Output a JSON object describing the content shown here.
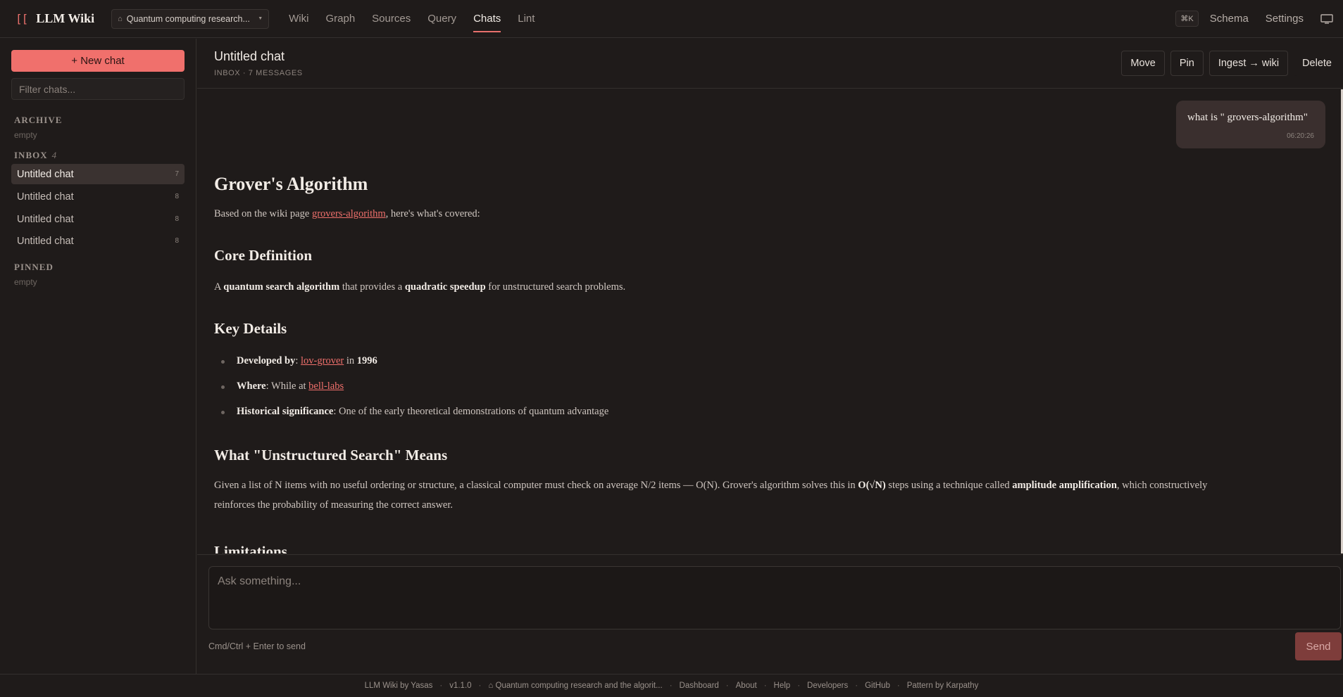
{
  "app": {
    "logo_mark": "[[",
    "title": "LLM Wiki",
    "project": "Quantum computing research...",
    "project_icon": "home-icon"
  },
  "nav": {
    "items": [
      {
        "label": "Wiki"
      },
      {
        "label": "Graph"
      },
      {
        "label": "Sources"
      },
      {
        "label": "Query"
      },
      {
        "label": "Chats",
        "active": true
      },
      {
        "label": "Lint"
      }
    ],
    "shortcut": "⌘K",
    "schema": "Schema",
    "settings": "Settings"
  },
  "sidebar": {
    "new_chat": "+ New chat",
    "filter_placeholder": "Filter chats...",
    "archive": {
      "title": "ARCHIVE",
      "empty": "empty"
    },
    "inbox": {
      "title": "INBOX",
      "count": "4",
      "items": [
        {
          "label": "Untitled chat",
          "count": "7",
          "active": true
        },
        {
          "label": "Untitled chat",
          "count": "8"
        },
        {
          "label": "Untitled chat",
          "count": "8"
        },
        {
          "label": "Untitled chat",
          "count": "8"
        }
      ]
    },
    "pinned": {
      "title": "PINNED",
      "empty": "empty"
    }
  },
  "chat": {
    "title": "Untitled chat",
    "subtitle": "INBOX · 7 MESSAGES",
    "buttons": {
      "move": "Move",
      "pin": "Pin",
      "ingest": "Ingest → wiki",
      "delete": "Delete"
    },
    "user_message": {
      "text": "what is \" grovers-algorithm\"",
      "time": "06:20:26"
    },
    "answer": {
      "h1": "Grover's Algorithm",
      "intro_prefix": "Based on the wiki page ",
      "intro_link": "grovers-algorithm",
      "intro_suffix": ", here's what's covered:",
      "core_heading": "Core Definition",
      "core_a": "A ",
      "core_b1": "quantum search algorithm",
      "core_c": " that provides a ",
      "core_b2": "quadratic speedup",
      "core_d": " for unstructured search problems.",
      "key_heading": "Key Details",
      "dev_label": "Developed by",
      "dev_sep": ": ",
      "dev_link": "lov-grover",
      "dev_in": " in ",
      "dev_year": "1996",
      "where_label": "Where",
      "where_text": ": While at ",
      "where_link": "bell-labs",
      "hist_label": "Historical significance",
      "hist_text": ": One of the early theoretical demonstrations of quantum advantage",
      "unstructured_heading": "What \"Unstructured Search\" Means",
      "us_a": "Given a list of N items with no useful ordering or structure, a classical computer must check on average N/2 items — O(N). Grover's algorithm solves this in ",
      "us_b1": "O(√N)",
      "us_c": " steps using a technique called ",
      "us_b2": "amplitude amplification",
      "us_d": ", which constructively reinforces the probability of measuring the correct answer.",
      "limitations_heading": "Limitations"
    }
  },
  "composer": {
    "placeholder": "Ask something...",
    "hint": "Cmd/Ctrl + Enter to send",
    "send": "Send"
  },
  "footer": {
    "items": [
      "LLM Wiki by Yasas",
      "v1.1.0",
      "⌂ Quantum computing research and the algorit...",
      "Dashboard",
      "About",
      "Help",
      "Developers",
      "GitHub",
      "Pattern by Karpathy"
    ],
    "separator": "·"
  },
  "colors": {
    "accent": "#f0706c",
    "background": "#1f1b1a",
    "border": "#34302e",
    "active_item": "#3a3230"
  }
}
